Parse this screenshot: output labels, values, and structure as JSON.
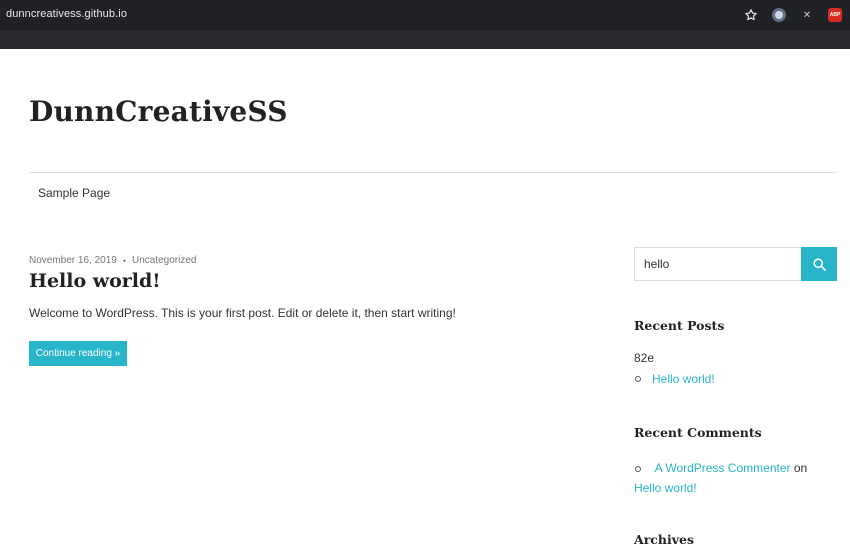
{
  "browser": {
    "url": "dunncreativess.github.io",
    "icons": [
      "star-icon",
      "extension-icon",
      "close-icon",
      "adblock-icon"
    ],
    "abp_label": "ABP"
  },
  "site": {
    "title": "DunnCreativeSS",
    "nav": [
      "Sample Page"
    ]
  },
  "post": {
    "date": "November 16, 2019",
    "separator": "•",
    "category": "Uncategorized",
    "title": "Hello world!",
    "excerpt": "Welcome to WordPress. This is your first post. Edit or delete it, then start writing!",
    "continue_label": "Continue reading »"
  },
  "sidebar": {
    "search_value": "hello",
    "recent_posts_title": "Recent Posts",
    "recent_posts_text": "82e",
    "recent_posts": [
      "Hello world!"
    ],
    "recent_comments_title": "Recent Comments",
    "comment_author": "A WordPress Commenter",
    "comment_on": "on",
    "comment_post": "Hello world!",
    "archives_title": "Archives"
  },
  "colors": {
    "accent": "#29b5c9",
    "chrome_bg": "#202124",
    "text": "#333333"
  }
}
